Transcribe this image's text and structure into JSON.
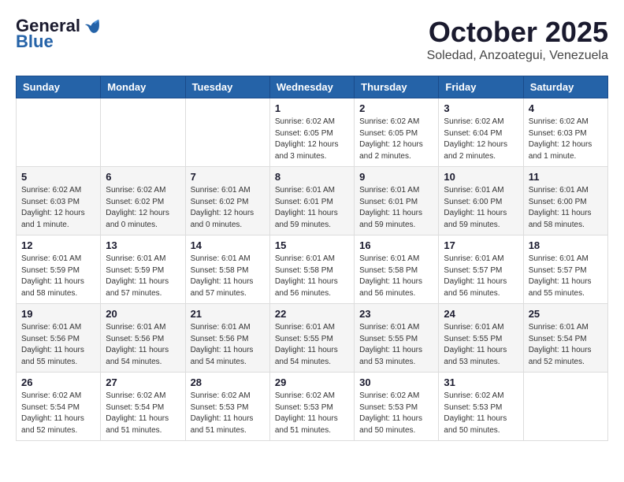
{
  "logo": {
    "general": "General",
    "blue": "Blue"
  },
  "title": "October 2025",
  "subtitle": "Soledad, Anzoategui, Venezuela",
  "days_of_week": [
    "Sunday",
    "Monday",
    "Tuesday",
    "Wednesday",
    "Thursday",
    "Friday",
    "Saturday"
  ],
  "weeks": [
    [
      {
        "day": "",
        "info": ""
      },
      {
        "day": "",
        "info": ""
      },
      {
        "day": "",
        "info": ""
      },
      {
        "day": "1",
        "info": "Sunrise: 6:02 AM\nSunset: 6:05 PM\nDaylight: 12 hours and 3 minutes."
      },
      {
        "day": "2",
        "info": "Sunrise: 6:02 AM\nSunset: 6:05 PM\nDaylight: 12 hours and 2 minutes."
      },
      {
        "day": "3",
        "info": "Sunrise: 6:02 AM\nSunset: 6:04 PM\nDaylight: 12 hours and 2 minutes."
      },
      {
        "day": "4",
        "info": "Sunrise: 6:02 AM\nSunset: 6:03 PM\nDaylight: 12 hours and 1 minute."
      }
    ],
    [
      {
        "day": "5",
        "info": "Sunrise: 6:02 AM\nSunset: 6:03 PM\nDaylight: 12 hours and 1 minute."
      },
      {
        "day": "6",
        "info": "Sunrise: 6:02 AM\nSunset: 6:02 PM\nDaylight: 12 hours and 0 minutes."
      },
      {
        "day": "7",
        "info": "Sunrise: 6:01 AM\nSunset: 6:02 PM\nDaylight: 12 hours and 0 minutes."
      },
      {
        "day": "8",
        "info": "Sunrise: 6:01 AM\nSunset: 6:01 PM\nDaylight: 11 hours and 59 minutes."
      },
      {
        "day": "9",
        "info": "Sunrise: 6:01 AM\nSunset: 6:01 PM\nDaylight: 11 hours and 59 minutes."
      },
      {
        "day": "10",
        "info": "Sunrise: 6:01 AM\nSunset: 6:00 PM\nDaylight: 11 hours and 59 minutes."
      },
      {
        "day": "11",
        "info": "Sunrise: 6:01 AM\nSunset: 6:00 PM\nDaylight: 11 hours and 58 minutes."
      }
    ],
    [
      {
        "day": "12",
        "info": "Sunrise: 6:01 AM\nSunset: 5:59 PM\nDaylight: 11 hours and 58 minutes."
      },
      {
        "day": "13",
        "info": "Sunrise: 6:01 AM\nSunset: 5:59 PM\nDaylight: 11 hours and 57 minutes."
      },
      {
        "day": "14",
        "info": "Sunrise: 6:01 AM\nSunset: 5:58 PM\nDaylight: 11 hours and 57 minutes."
      },
      {
        "day": "15",
        "info": "Sunrise: 6:01 AM\nSunset: 5:58 PM\nDaylight: 11 hours and 56 minutes."
      },
      {
        "day": "16",
        "info": "Sunrise: 6:01 AM\nSunset: 5:58 PM\nDaylight: 11 hours and 56 minutes."
      },
      {
        "day": "17",
        "info": "Sunrise: 6:01 AM\nSunset: 5:57 PM\nDaylight: 11 hours and 56 minutes."
      },
      {
        "day": "18",
        "info": "Sunrise: 6:01 AM\nSunset: 5:57 PM\nDaylight: 11 hours and 55 minutes."
      }
    ],
    [
      {
        "day": "19",
        "info": "Sunrise: 6:01 AM\nSunset: 5:56 PM\nDaylight: 11 hours and 55 minutes."
      },
      {
        "day": "20",
        "info": "Sunrise: 6:01 AM\nSunset: 5:56 PM\nDaylight: 11 hours and 54 minutes."
      },
      {
        "day": "21",
        "info": "Sunrise: 6:01 AM\nSunset: 5:56 PM\nDaylight: 11 hours and 54 minutes."
      },
      {
        "day": "22",
        "info": "Sunrise: 6:01 AM\nSunset: 5:55 PM\nDaylight: 11 hours and 54 minutes."
      },
      {
        "day": "23",
        "info": "Sunrise: 6:01 AM\nSunset: 5:55 PM\nDaylight: 11 hours and 53 minutes."
      },
      {
        "day": "24",
        "info": "Sunrise: 6:01 AM\nSunset: 5:55 PM\nDaylight: 11 hours and 53 minutes."
      },
      {
        "day": "25",
        "info": "Sunrise: 6:01 AM\nSunset: 5:54 PM\nDaylight: 11 hours and 52 minutes."
      }
    ],
    [
      {
        "day": "26",
        "info": "Sunrise: 6:02 AM\nSunset: 5:54 PM\nDaylight: 11 hours and 52 minutes."
      },
      {
        "day": "27",
        "info": "Sunrise: 6:02 AM\nSunset: 5:54 PM\nDaylight: 11 hours and 51 minutes."
      },
      {
        "day": "28",
        "info": "Sunrise: 6:02 AM\nSunset: 5:53 PM\nDaylight: 11 hours and 51 minutes."
      },
      {
        "day": "29",
        "info": "Sunrise: 6:02 AM\nSunset: 5:53 PM\nDaylight: 11 hours and 51 minutes."
      },
      {
        "day": "30",
        "info": "Sunrise: 6:02 AM\nSunset: 5:53 PM\nDaylight: 11 hours and 50 minutes."
      },
      {
        "day": "31",
        "info": "Sunrise: 6:02 AM\nSunset: 5:53 PM\nDaylight: 11 hours and 50 minutes."
      },
      {
        "day": "",
        "info": ""
      }
    ]
  ]
}
